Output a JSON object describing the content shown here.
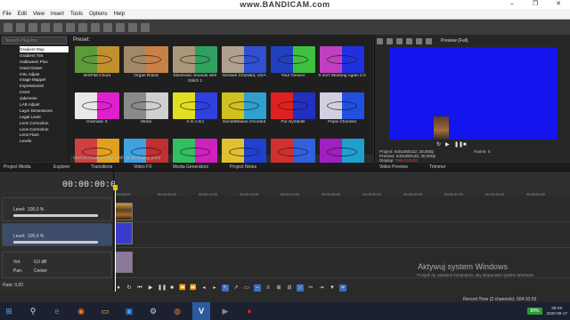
{
  "watermark": "www.BANDICAM.com",
  "window_controls": [
    "–",
    "❐",
    "✕"
  ],
  "menu": [
    "File",
    "Edit",
    "View",
    "Insert",
    "Tools",
    "Options",
    "Help"
  ],
  "explorer": {
    "search_placeholder": "Search Plug-Ins",
    "items": [
      "Gradient Map",
      "Gradient Tint",
      "Halloween Plus",
      "Hand Drawn",
      "HSL Adjust",
      "Image Mapper",
      "Impressionist",
      "Invert",
      "Jakrzenie",
      "LAB Adjust",
      "Layer Dimensions",
      "Legal Level",
      "Lens Correction",
      "Lens Correction",
      "Lens Flare",
      "Levels"
    ],
    "selected": 0
  },
  "presets": {
    "title": "Preset:",
    "items": [
      {
        "label": "WXPiM Chord",
        "left": "#5d9a3a",
        "right": "#c09030"
      },
      {
        "label": "Organ Robot",
        "left": "#a08868",
        "right": "#c88048"
      },
      {
        "label": "Electronic Sounds with Glitch 1",
        "left": "#a89878",
        "right": "#30a060"
      },
      {
        "label": "Gensee Chorded, USA",
        "left": "#b0a090",
        "right": "#3050d0"
      },
      {
        "label": "Your Clearer",
        "left": "#2040c0",
        "right": "#40c040"
      },
      {
        "label": "X Isn't Working Again 2.0",
        "left": "#c040c0",
        "right": "#2030e0"
      },
      {
        "label": "Dramatic X",
        "left": "#e8e8e8",
        "right": "#e020d0"
      },
      {
        "label": "Metal",
        "left": "#8a8a8a",
        "right": "#d0d0d0"
      },
      {
        "label": "X Is A DJ",
        "left": "#e0e020",
        "right": "#3040e0"
      },
      {
        "label": "GoroblMakan Chorded",
        "left": "#d0c020",
        "right": "#30a0d0"
      },
      {
        "label": "For Symbols",
        "left": "#e02020",
        "right": "#2030c0"
      },
      {
        "label": "Pepsi Chorded",
        "left": "#d0d0e0",
        "right": "#2050e0"
      },
      {
        "label": "",
        "left": "#d04040",
        "right": "#e0a020"
      },
      {
        "label": "",
        "left": "#40a0e0",
        "right": "#c03030"
      },
      {
        "label": "",
        "left": "#30c060",
        "right": "#d020c0"
      },
      {
        "label": "",
        "left": "#e0c030",
        "right": "#2040d0"
      },
      {
        "label": "",
        "left": "#d03030",
        "right": "#3060e0"
      },
      {
        "label": "",
        "left": "#a020c0",
        "right": "#20a0d0"
      }
    ],
    "status": "VEGAS Gradient Map, OXF, 32-bit floating point"
  },
  "preview": {
    "mode_label": "Preview (Full)",
    "frame_color": "#1414ee",
    "project": "Project:    640x360x32; 30,000p",
    "preview_res": "Preview:   640x360x32; 30,000p",
    "display": "Display:   ",
    "display_value": "796x223x32",
    "frame_label": "Frame:",
    "frame_value": "0",
    "video_label": "Video Preview",
    "trimmer_label": "Trimmer"
  },
  "tabs": [
    {
      "label": "Project Media"
    },
    {
      "label": "Explorer"
    },
    {
      "label": "Transitions"
    },
    {
      "label": "Video FX"
    },
    {
      "label": "Media Generators"
    },
    {
      "label": "Project Notes"
    }
  ],
  "timeline": {
    "timecode": "00:00:00:00",
    "ticks": [
      "00:00:00",
      "00:00:05:00",
      "00:00:10:00",
      "00:00:15:00",
      "00:00:20:00",
      "00:00:25:00",
      "00:00:30:00",
      "00:00:35:00",
      "00:00:40:00",
      "00:00:45:00",
      "00:00:50:00"
    ],
    "tracks": [
      {
        "label": "Level:",
        "value": "100,0 %"
      },
      {
        "label": "Level:",
        "value": "100,0 %"
      }
    ],
    "audio": {
      "vol_label": "Vol:",
      "vol_value": "0,0 dB",
      "pan_label": "Pan:",
      "pan_value": "Center"
    },
    "rate": "Rate: 0,00",
    "record_time": "Record Time (2 channels): 604:10:53"
  },
  "windows_activation": {
    "line1": "Aktywuj system Windows",
    "line2": "Przejdź do ustawień komputera, aby aktywować system Windows."
  },
  "taskbar": {
    "battery": "89%",
    "time": "09:49",
    "date": "2020-08-17"
  }
}
